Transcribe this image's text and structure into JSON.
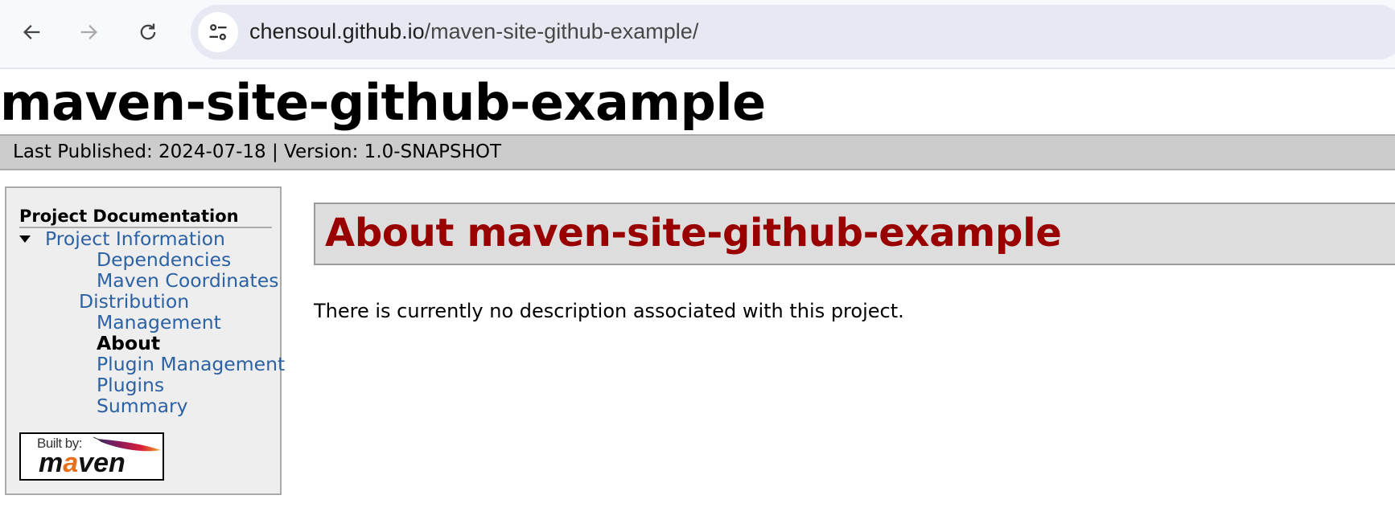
{
  "browser": {
    "url_host": "chensoul.github.io",
    "url_path": "/maven-site-github-example/",
    "icons": [
      "back-arrow-icon",
      "forward-arrow-icon",
      "reload-icon",
      "site-settings-icon"
    ]
  },
  "site": {
    "title": "maven-site-github-example",
    "breadcrumb": "Last Published: 2024-07-18 | Version: 1.0-SNAPSHOT"
  },
  "sidebar": {
    "heading": "Project Documentation",
    "parent": {
      "label": "Project Information",
      "expanded": true
    },
    "items": [
      {
        "label": "Dependencies",
        "active": false
      },
      {
        "label": "Maven Coordinates",
        "active": false
      },
      {
        "label": "Distribution Management",
        "active": false
      },
      {
        "label": "About",
        "active": true
      },
      {
        "label": "Plugin Management",
        "active": false
      },
      {
        "label": "Plugins",
        "active": false
      },
      {
        "label": "Summary",
        "active": false
      }
    ],
    "built_by": {
      "label": "Built by:",
      "brand_pre": "m",
      "brand_accent": "a",
      "brand_post": "ven"
    }
  },
  "main": {
    "heading": "About maven-site-github-example",
    "description": "There is currently no description associated with this project."
  },
  "colors": {
    "link": "#2c62a4",
    "heading_red": "#990000",
    "breadcrumb_bg": "#cccccc",
    "sidebar_bg": "#eeeeee",
    "heading_bg": "#dddddd"
  }
}
